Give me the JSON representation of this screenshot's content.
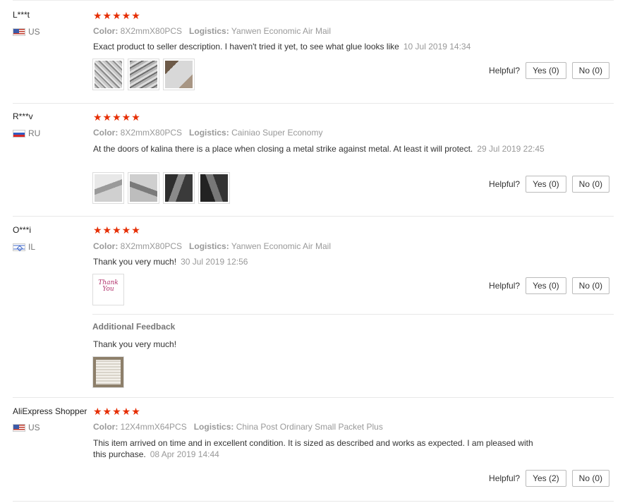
{
  "labels": {
    "color": "Color:",
    "logistics": "Logistics:",
    "helpful": "Helpful?",
    "additional_feedback": "Additional Feedback"
  },
  "reviews": [
    {
      "name": "L***t",
      "country": "US",
      "stars": "★★★★★",
      "color": "8X2mmX80PCS",
      "logistics": "Yanwen Economic Air Mail",
      "text": "Exact product to seller description. I haven't tried it yet, to see what glue looks like",
      "date": "10 Jul 2019 14:34",
      "yes": "Yes (0)",
      "no": "No (0)"
    },
    {
      "name": "R***v",
      "country": "RU",
      "stars": "★★★★★",
      "color": "8X2mmX80PCS",
      "logistics": "Cainiao Super Economy",
      "text": "At the doors of kalina there is a place when closing a metal strike against metal. At least it will protect.",
      "date": "29 Jul 2019 22:45",
      "yes": "Yes (0)",
      "no": "No (0)"
    },
    {
      "name": "O***i",
      "country": "IL",
      "stars": "★★★★★",
      "color": "8X2mmX80PCS",
      "logistics": "Yanwen Economic Air Mail",
      "text": "Thank you very much!",
      "date": "30 Jul 2019 12:56",
      "yes": "Yes (0)",
      "no": "No (0)",
      "additional_text": "Thank you very much!",
      "thumb_text": "Thank You"
    },
    {
      "name": "AliExpress Shopper",
      "country": "US",
      "stars": "★★★★★",
      "color": "12X4mmX64PCS",
      "logistics": "China Post Ordinary Small Packet Plus",
      "text": "This item arrived on time and in excellent condition. It is sized as described and works as expected. I am pleased with this purchase.",
      "date": "08 Apr 2019 14:44",
      "yes": "Yes (2)",
      "no": "No (0)"
    }
  ],
  "colors": {
    "star": "#e62e04",
    "muted": "#999999",
    "border": "#e8e8e8"
  }
}
